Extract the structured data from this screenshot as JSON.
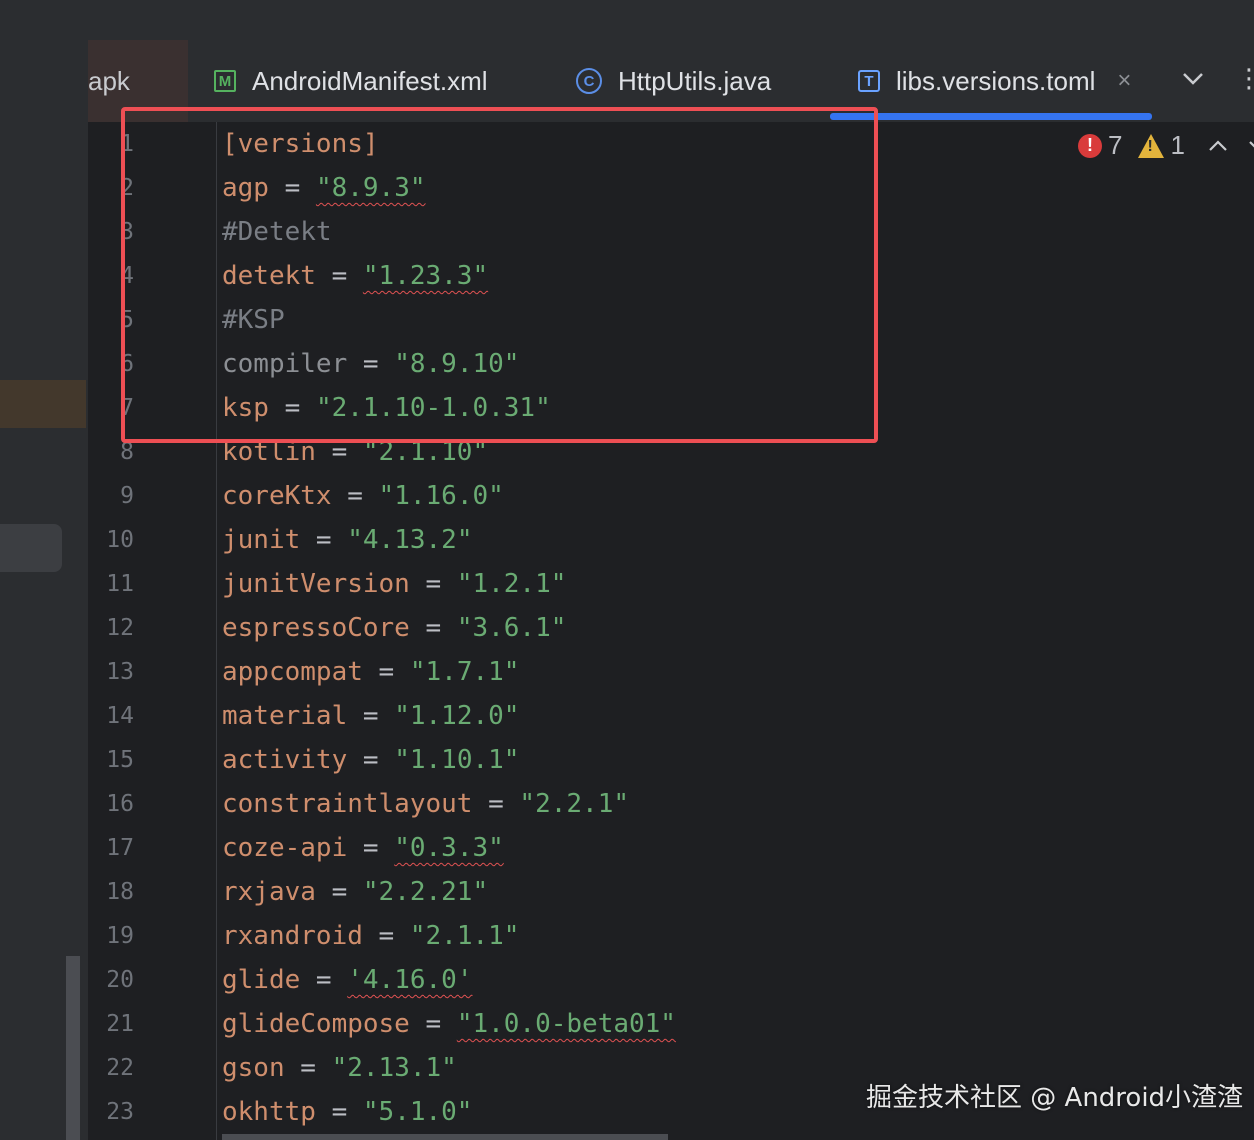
{
  "tabs": {
    "partial": {
      "label": "apk"
    },
    "manifest": {
      "label": "AndroidManifest.xml",
      "icon": "M"
    },
    "http": {
      "label": "HttpUtils.java",
      "icon": "C"
    },
    "toml": {
      "label": "libs.versions.toml",
      "icon": "T",
      "close": "×"
    },
    "active_color": "#3574f0"
  },
  "inspections": {
    "errors": "7",
    "warnings": "1"
  },
  "editor": {
    "lines": [
      {
        "num": "1",
        "section": "[versions]"
      },
      {
        "num": "2",
        "key": "agp",
        "eq": " = ",
        "value": "\"8.9.3\""
      },
      {
        "num": "3",
        "comment": "#Detekt"
      },
      {
        "num": "4",
        "key": "detekt",
        "eq": " = ",
        "value": "\"1.23.3\""
      },
      {
        "num": "5",
        "comment": "#KSP"
      },
      {
        "num": "6",
        "key": "compiler",
        "eq": " = ",
        "value": "\"8.9.10\""
      },
      {
        "num": "7",
        "key": "ksp",
        "eq": " = ",
        "value": "\"2.1.10-1.0.31\""
      },
      {
        "num": "8",
        "key": "kotlin",
        "eq": " = ",
        "value": "\"2.1.10\""
      },
      {
        "num": "9",
        "key": "coreKtx",
        "eq": " = ",
        "value": "\"1.16.0\""
      },
      {
        "num": "10",
        "key": "junit",
        "eq": " = ",
        "value": "\"4.13.2\""
      },
      {
        "num": "11",
        "key": "junitVersion",
        "eq": " = ",
        "value": "\"1.2.1\""
      },
      {
        "num": "12",
        "key": "espressoCore",
        "eq": " = ",
        "value": "\"3.6.1\""
      },
      {
        "num": "13",
        "key": "appcompat",
        "eq": " = ",
        "value": "\"1.7.1\""
      },
      {
        "num": "14",
        "key": "material",
        "eq": " = ",
        "value": "\"1.12.0\""
      },
      {
        "num": "15",
        "key": "activity",
        "eq": " = ",
        "value": "\"1.10.1\""
      },
      {
        "num": "16",
        "key": "constraintlayout",
        "eq": " = ",
        "value": "\"2.2.1\""
      },
      {
        "num": "17",
        "key": "coze-api",
        "eq": " = ",
        "value": "\"0.3.3\""
      },
      {
        "num": "18",
        "key": "rxjava",
        "eq": " = ",
        "value": "\"2.2.21\""
      },
      {
        "num": "19",
        "key": "rxandroid",
        "eq": " = ",
        "value": "\"2.1.1\""
      },
      {
        "num": "20",
        "key": "glide",
        "eq": " = ",
        "value": "'4.16.0'"
      },
      {
        "num": "21",
        "key": "glideCompose",
        "eq": " = ",
        "value": "\"1.0.0-beta01\""
      },
      {
        "num": "22",
        "key": "gson",
        "eq": " = ",
        "value": "\"2.13.1\""
      },
      {
        "num": "23",
        "key": "okhttp",
        "eq": " = ",
        "value": "\"5.1.0\""
      }
    ]
  },
  "annotation": {
    "color": "#ee4f54"
  },
  "watermark": "掘金技术社区 @ Android小渣渣"
}
